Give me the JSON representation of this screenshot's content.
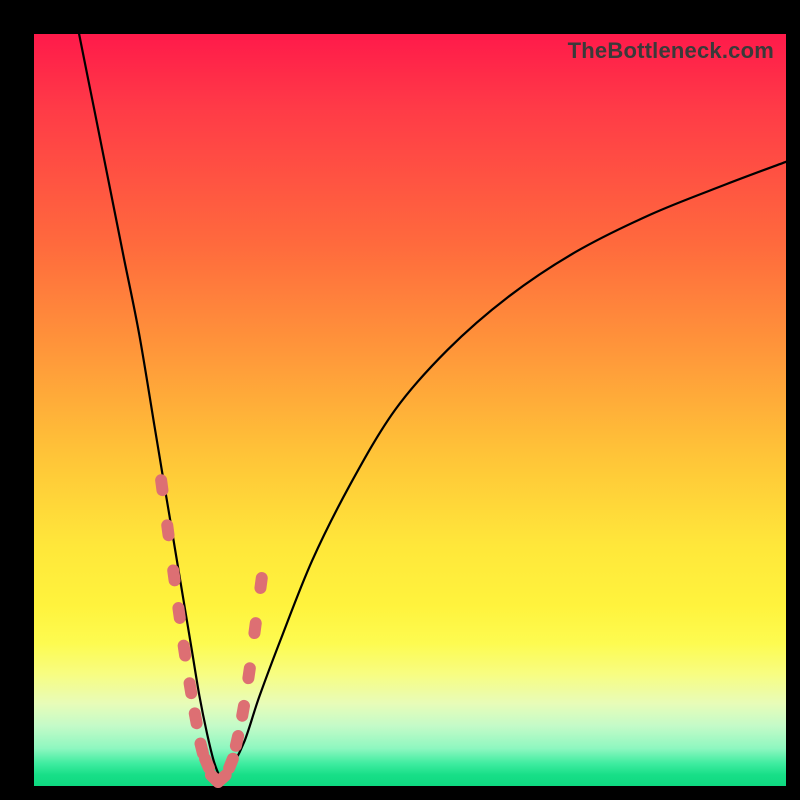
{
  "watermark": "TheBottleneck.com",
  "colors": {
    "background": "#000000",
    "gradient_top": "#ff1a4a",
    "gradient_bottom": "#0ed880",
    "curve": "#000000",
    "marker": "#dd6f73"
  },
  "chart_data": {
    "type": "line",
    "title": "",
    "xlabel": "",
    "ylabel": "",
    "xlim": [
      0,
      100
    ],
    "ylim": [
      0,
      100
    ],
    "series": [
      {
        "name": "bottleneck-curve",
        "x": [
          6,
          8,
          10,
          12,
          14,
          16,
          17,
          18,
          19,
          20,
          21,
          22,
          23,
          24,
          25,
          26,
          28,
          30,
          33,
          37,
          42,
          48,
          55,
          63,
          72,
          82,
          92,
          100
        ],
        "y": [
          100,
          90,
          80,
          70,
          60,
          48,
          42,
          36,
          30,
          24,
          18,
          12,
          7,
          3,
          1,
          2,
          6,
          12,
          20,
          30,
          40,
          50,
          58,
          65,
          71,
          76,
          80,
          83
        ]
      }
    ],
    "markers": {
      "name": "highlight-points",
      "x": [
        17.0,
        17.8,
        18.6,
        19.3,
        20.0,
        20.8,
        21.5,
        22.3,
        23.0,
        24.0,
        25.0,
        26.2,
        27.0,
        27.8,
        28.6,
        29.4,
        30.2
      ],
      "y": [
        40,
        34,
        28,
        23,
        18,
        13,
        9,
        5,
        3,
        1,
        1,
        3,
        6,
        10,
        15,
        21,
        27
      ]
    }
  }
}
